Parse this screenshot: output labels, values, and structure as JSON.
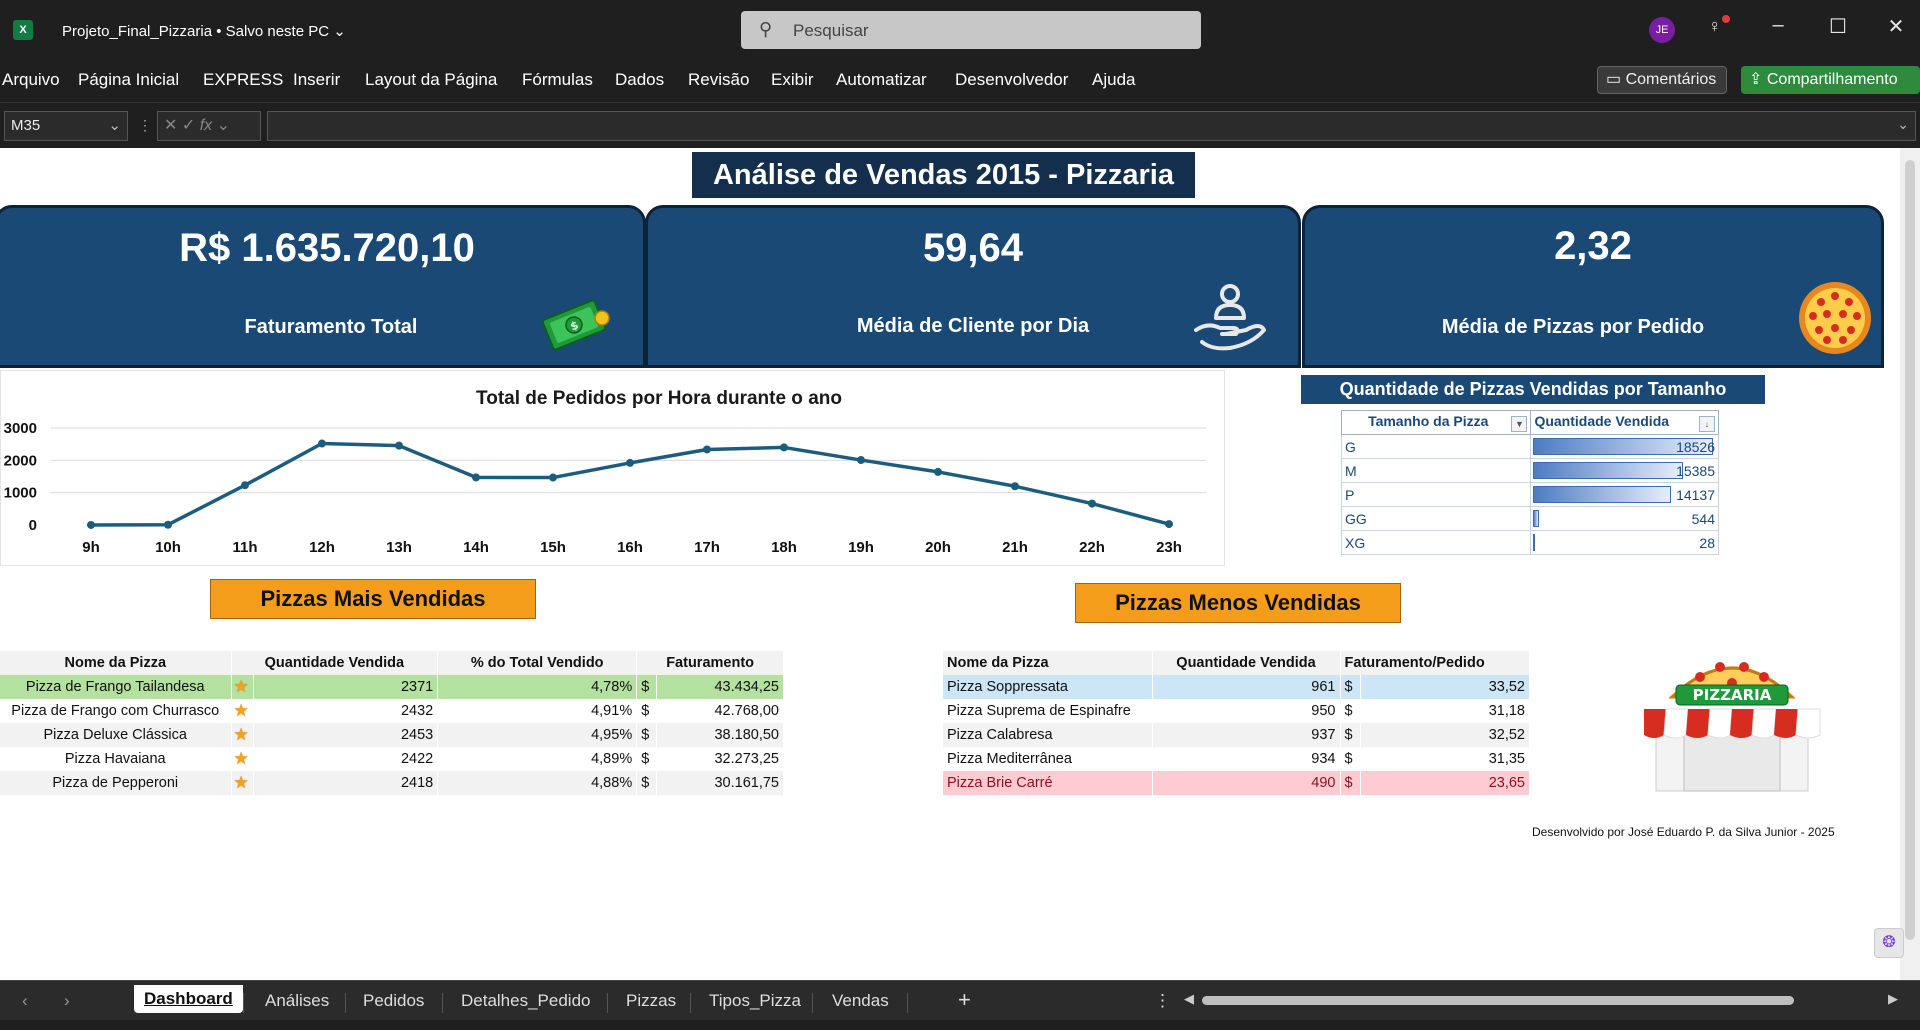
{
  "window": {
    "app_icon": "X",
    "doc_title": "Projeto_Final_Pizzaria  •  Salvo neste PC",
    "search_placeholder": "Pesquisar",
    "user_initials": "JE"
  },
  "menu": [
    "Arquivo",
    "Página Inicial",
    "EXPRESS",
    "Inserir",
    "Layout da Página",
    "Fórmulas",
    "Dados",
    "Revisão",
    "Exibir",
    "Automatizar",
    "Desenvolvedor",
    "Ajuda"
  ],
  "ribbon_buttons": {
    "comments": "Comentários",
    "share": "Compartilhamento"
  },
  "formula_bar": {
    "cell": "M35",
    "fx": "fx",
    "value": ""
  },
  "dashboard": {
    "title": "Análise de Vendas 2015 - Pizzaria",
    "kpis": [
      {
        "value": "R$ 1.635.720,10",
        "label": "Faturamento Total",
        "icon": "money-icon"
      },
      {
        "value": "59,64",
        "label": "Média de Cliente por Dia",
        "icon": "customer-hand-icon"
      },
      {
        "value": "2,32",
        "label": "Média de Pizzas por Pedido",
        "icon": "pizza-icon"
      }
    ],
    "size_section": {
      "title": "Quantidade de Pizzas Vendidas por Tamanho",
      "headers": [
        "Tamanho da Pizza",
        "Quantidade Vendida"
      ],
      "rows": [
        {
          "size": "G",
          "qty": "18526",
          "value": 18526
        },
        {
          "size": "M",
          "qty": "15385",
          "value": 15385
        },
        {
          "size": "P",
          "qty": "14137",
          "value": 14137
        },
        {
          "size": "GG",
          "qty": "544",
          "value": 544
        },
        {
          "size": "XG",
          "qty": "28",
          "value": 28
        }
      ]
    },
    "top_title": "Pizzas Mais Vendidas",
    "top_headers": [
      "Nome da Pizza",
      "Quantidade Vendida",
      "% do Total Vendido",
      "Faturamento"
    ],
    "top_rows": [
      {
        "name": "Pizza de Frango Tailandesa",
        "qty": "2371",
        "pct": "4,78%",
        "cur": "$",
        "rev": "43.434,25"
      },
      {
        "name": "Pizza de Frango com Churrasco",
        "qty": "2432",
        "pct": "4,91%",
        "cur": "$",
        "rev": "42.768,00"
      },
      {
        "name": "Pizza Deluxe Clássica",
        "qty": "2453",
        "pct": "4,95%",
        "cur": "$",
        "rev": "38.180,50"
      },
      {
        "name": "Pizza Havaiana",
        "qty": "2422",
        "pct": "4,89%",
        "cur": "$",
        "rev": "32.273,25"
      },
      {
        "name": "Pizza de Pepperoni",
        "qty": "2418",
        "pct": "4,88%",
        "cur": "$",
        "rev": "30.161,75"
      }
    ],
    "low_title": "Pizzas Menos Vendidas",
    "low_headers": [
      "Nome da Pizza",
      "Quantidade Vendida",
      "Faturamento/Pedido"
    ],
    "low_rows": [
      {
        "name": "Pizza Soppressata",
        "qty": "961",
        "cur": "$",
        "rev": "33,52"
      },
      {
        "name": "Pizza Suprema de Espinafre",
        "qty": "950",
        "cur": "$",
        "rev": "31,18"
      },
      {
        "name": "Pizza Calabresa",
        "qty": "937",
        "cur": "$",
        "rev": "32,52"
      },
      {
        "name": "Pizza Mediterrânea",
        "qty": "934",
        "cur": "$",
        "rev": "31,35"
      },
      {
        "name": "Pizza Brie Carré",
        "qty": "490",
        "cur": "$",
        "rev": "23,65"
      }
    ],
    "shop_sign": "PIZZARIA",
    "credit": "Desenvolvido por José Eduardo P. da Silva Junior - 2025"
  },
  "chart_data": {
    "type": "line",
    "title": "Total de Pedidos por Hora durante o ano",
    "categories": [
      "9h",
      "10h",
      "11h",
      "12h",
      "13h",
      "14h",
      "15h",
      "16h",
      "17h",
      "18h",
      "19h",
      "20h",
      "21h",
      "22h",
      "23h"
    ],
    "values": [
      1,
      8,
      1231,
      2520,
      2455,
      1472,
      1468,
      1920,
      2336,
      2399,
      2009,
      1642,
      1198,
      663,
      28
    ],
    "ylim": [
      0,
      3000
    ],
    "yticks": [
      "0",
      "1000",
      "2000",
      "3000"
    ],
    "grid": true,
    "color": "#1c5d7e"
  },
  "sheet_tabs": [
    "Dashboard",
    "Análises",
    "Pedidos",
    "Detalhes_Pedido",
    "Pizzas",
    "Tipos_Pizza",
    "Vendas"
  ],
  "add_sheet": "+",
  "colors": {
    "kpi_bg": "#1b4975",
    "title_bg": "#132f4d",
    "section_orange": "#f49d1b",
    "top_green": "#b4e1a0",
    "low_pink": "#ffcbd3"
  }
}
